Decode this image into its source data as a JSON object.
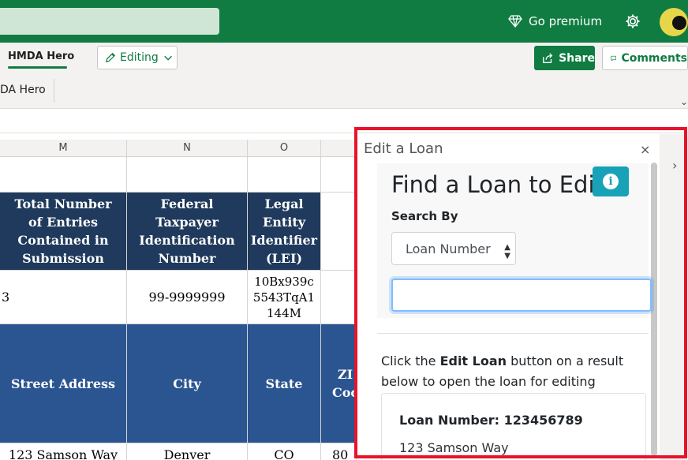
{
  "topbar": {
    "premium_label": "Go premium"
  },
  "ribbon": {
    "tab_label": "HMDA Hero",
    "editing_label": "Editing",
    "share_label": "Share",
    "comments_label": "Comments",
    "group_label": "DA Hero"
  },
  "sheet": {
    "columns": [
      "M",
      "N",
      "O"
    ],
    "header_row": {
      "m": "Total Number of Entries Contained in Submission",
      "n": "Federal Taxpayer Identification Number",
      "o": "Legal Entity Identifier (LEI)"
    },
    "data_row": {
      "m": "3",
      "n": "99-9999999",
      "o": "10Bx939c5543TqA1144M"
    },
    "header_row2": {
      "m": "Street Address",
      "n": "City",
      "o": "State",
      "p": "ZI Coc"
    },
    "data_row2": {
      "m": "123 Samson Way",
      "n": "Denver",
      "o": "CO",
      "p": "80"
    }
  },
  "panel": {
    "title": "Edit a Loan",
    "close": "×",
    "find_title": "Find a Loan to Edit",
    "search_by_label": "Search By",
    "select_value": "Loan Number",
    "instructions_pre": "Click the ",
    "instructions_bold": "Edit Loan",
    "instructions_post": " button on a result below to open the loan for editing",
    "result": {
      "loan_number": "Loan Number: 123456789",
      "address": "123 Samson Way"
    }
  },
  "colors": {
    "brand_green": "#107c41",
    "header_dark": "#1f3a5c",
    "header_mid": "#2b5590",
    "info": "#17a2b8",
    "highlight": "#e8132a"
  }
}
